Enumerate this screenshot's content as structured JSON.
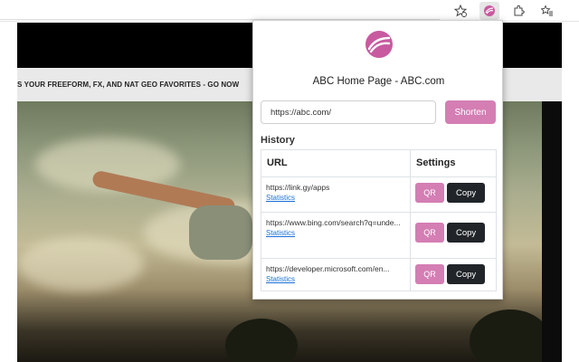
{
  "browser": {
    "toolbar_icons": [
      "favorite-add-icon",
      "extension-link-icon",
      "extensions-icon",
      "favorites-icon"
    ]
  },
  "page": {
    "banner_text": "S YOUR FREEFORM, FX, AND NAT GEO FAVORITES - GO NOW"
  },
  "popup": {
    "page_title": "ABC Home Page - ABC.com",
    "url_input_value": "https://abc.com/",
    "shorten_label": "Shorten",
    "history_label": "History",
    "columns": {
      "url": "URL",
      "settings": "Settings"
    },
    "rows": [
      {
        "url": "https://link.gy/apps",
        "stats": "Statistics",
        "qr": "QR",
        "copy": "Copy"
      },
      {
        "url": "https://www.bing.com/search?q=unde...",
        "stats": "Statistics",
        "qr": "QR",
        "copy": "Copy"
      },
      {
        "url": "https://developer.microsoft.com/en...",
        "stats": "Statistics",
        "qr": "QR",
        "copy": "Copy"
      }
    ],
    "accent_color": "#d47eb4",
    "dark_button_color": "#212529"
  }
}
